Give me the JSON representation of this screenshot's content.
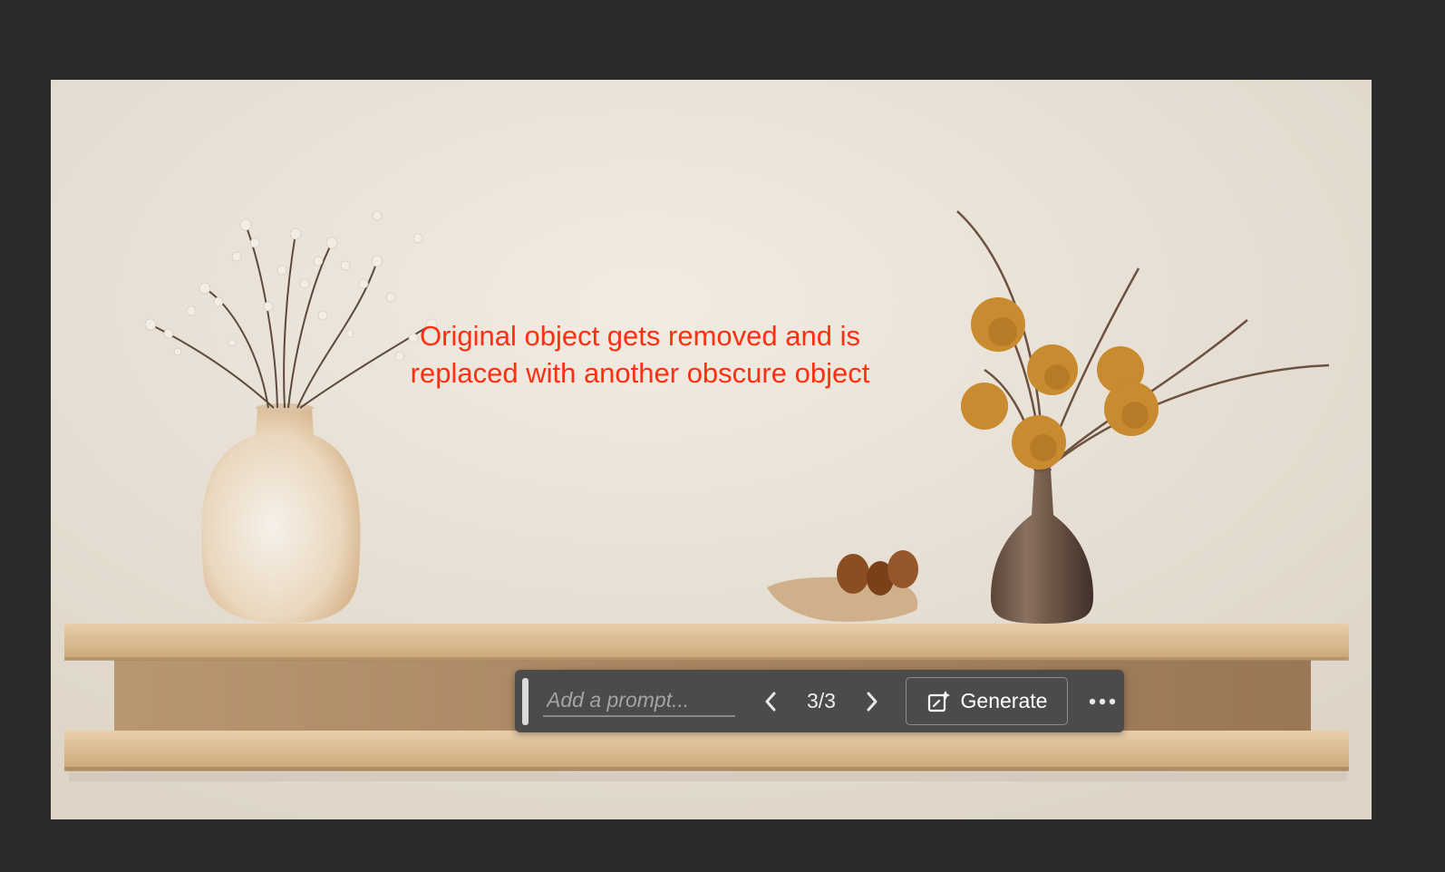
{
  "canvas": {
    "annotation": "Original object gets removed and is replaced with another obscure object"
  },
  "taskbar": {
    "prompt_placeholder": "Add a prompt...",
    "prompt_value": "",
    "variation_counter": "3/3",
    "generate_label": "Generate",
    "icons": {
      "previous": "chevron-left-icon",
      "next": "chevron-right-icon",
      "generate": "generative-fill-icon",
      "more": "more-options-icon"
    }
  },
  "colors": {
    "app_background": "#2a2a2a",
    "taskbar_background": "#4b4b4b",
    "annotation_text": "#ff2f12"
  }
}
